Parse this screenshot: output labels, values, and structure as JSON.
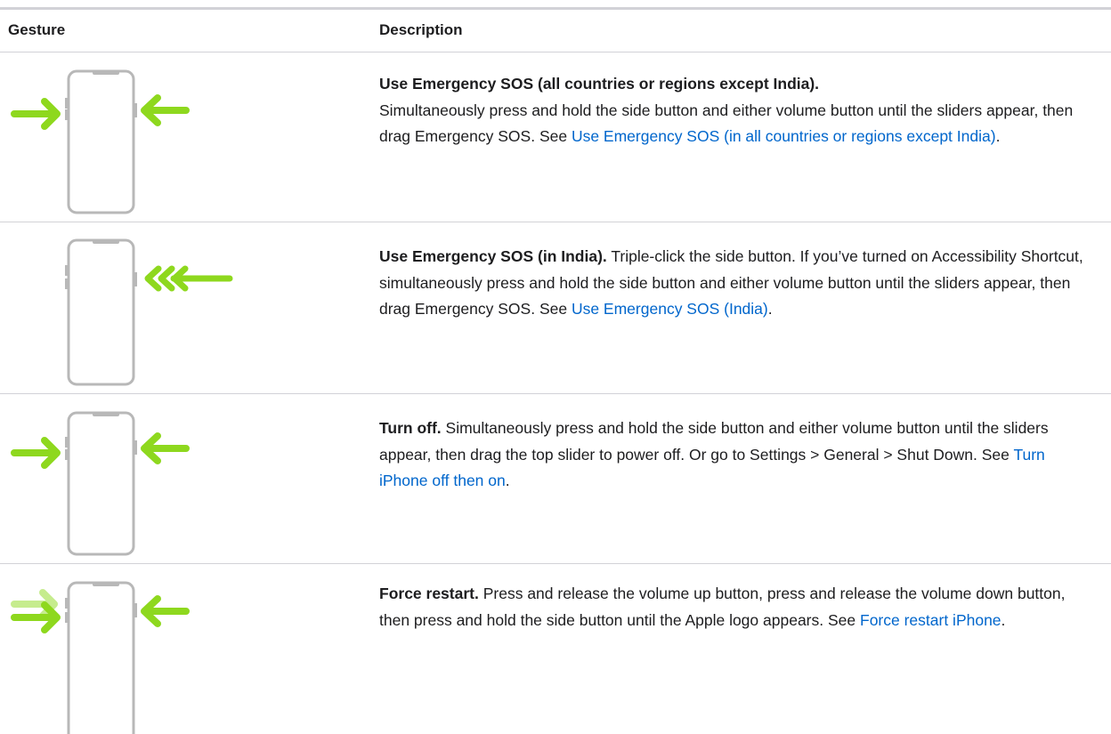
{
  "table": {
    "headers": {
      "gesture": "Gesture",
      "description": "Description"
    },
    "rows": [
      {
        "title": "Use Emergency SOS (all countries or regions except India).",
        "text": "Simultaneously press and hold the side button and either volume button until the sliders appear, then drag Emergency SOS. See",
        "link": "Use Emergency SOS (in all countries or regions except India)",
        "end": ".",
        "illustration": "iphone-press-side-and-volume-illustration"
      },
      {
        "title": "Use Emergency SOS (in India).",
        "text": "Triple-click the side button. If you’ve turned on Accessibility Shortcut, simultaneously press and hold the side button and either volume button until the sliders appear, then drag Emergency SOS. See",
        "link": "Use Emergency SOS (India)",
        "end": ".",
        "illustration": "iphone-triple-click-side-illustration"
      },
      {
        "title": "Turn off.",
        "text": "Simultaneously press and hold the side button and either volume button until the sliders appear, then drag the top slider to power off. Or go to Settings > General > Shut Down. See",
        "link": "Turn iPhone off then on",
        "end": ".",
        "illustration": "iphone-press-side-and-volume-illustration"
      },
      {
        "title": "Force restart.",
        "text": "Press and release the volume up button, press and release the volume down button, then press and hold the side button until the Apple logo appears. See",
        "link": "Force restart iPhone",
        "end": ".",
        "illustration": "iphone-force-restart-illustration"
      }
    ]
  },
  "colors": {
    "arrow": "#8ed81e",
    "arrow_faded": "#c6ec8e",
    "phone_outline": "#b8b8b8",
    "link": "#0066cc",
    "rule": "#d2d2d7"
  }
}
